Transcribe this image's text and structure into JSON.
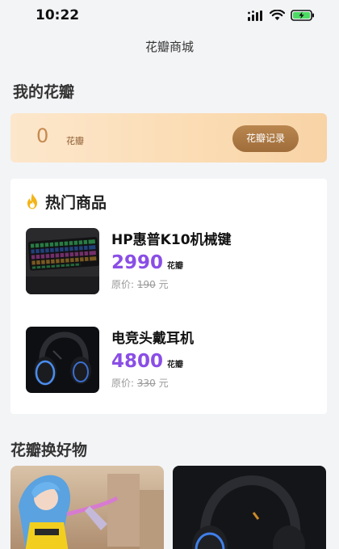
{
  "status": {
    "time": "10:22"
  },
  "nav": {
    "title": "花瓣商城"
  },
  "points": {
    "section_title": "我的花瓣",
    "value": "0",
    "unit": "花瓣",
    "record_button": "花瓣记录"
  },
  "hot": {
    "title": "热门商品",
    "products": [
      {
        "name": "HP惠普K10机械键",
        "price": "2990",
        "price_unit": "花瓣",
        "orig_label": "原价:",
        "orig_value": "190",
        "orig_unit": "元"
      },
      {
        "name": "电竞头戴耳机",
        "price": "4800",
        "price_unit": "花瓣",
        "orig_label": "原价:",
        "orig_value": "330",
        "orig_unit": "元"
      }
    ]
  },
  "goods": {
    "section_title": "花瓣换好物"
  },
  "colors": {
    "accent_price": "#8a4ee6",
    "points_gold": "#c58a4f",
    "flame": "#f2b417"
  },
  "icons": [
    "signal-icon",
    "wifi-icon",
    "battery-charging-icon",
    "flame-icon"
  ]
}
